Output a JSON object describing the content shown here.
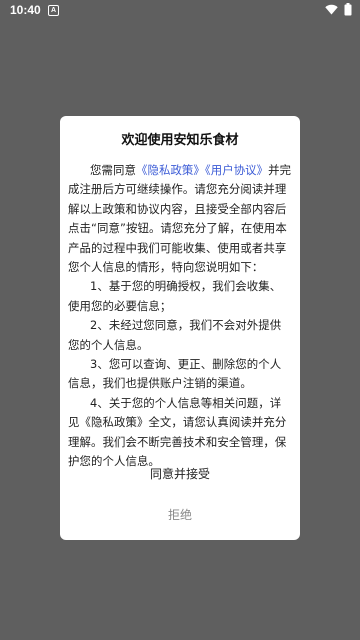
{
  "status_bar": {
    "time": "10:40",
    "notification_icon_text": "A",
    "icons": [
      "wifi-icon",
      "battery-icon"
    ]
  },
  "dialog": {
    "title": "欢迎使用安知乐食材",
    "intro_before": "您需同意",
    "privacy_link": "《隐私政策》",
    "user_agreement_link": "《用户协议》",
    "intro_after": "并完成注册后方可继续操作。请您充分阅读并理解以上政策和协议内容，且接受全部内容后点击“同意”按钮。请您充分了解，在使用本产品的过程中我们可能收集、使用或者共享您个人信息的情形，特向您说明如下：",
    "item1": "1、基于您的明确授权，我们会收集、使用您的必要信息；",
    "item2": "2、未经过您同意，我们不会对外提供您的个人信息。",
    "item3": "3、您可以查询、更正、删除您的个人信息，我们也提供账户注销的渠道。",
    "item4": "4、关于您的个人信息等相关问题，详见《隐私政策》全文，请您认真阅读并充分理解。我们会不断完善技术和安全管理，保护您的个人信息。",
    "agree_label": "同意并接受",
    "refuse_label": "拒绝"
  },
  "colors": {
    "overlay": "#5f5f5f",
    "link": "#3b5bd6",
    "refuse_text": "#888888"
  }
}
